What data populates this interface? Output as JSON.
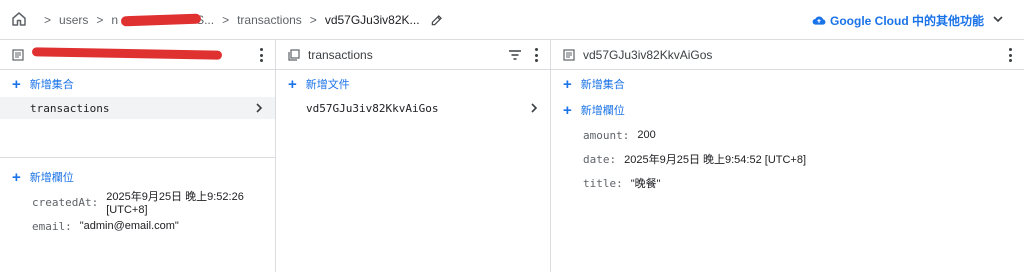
{
  "breadcrumb": {
    "items": [
      "users",
      "n",
      "transactions",
      "vd57GJu3iv82K..."
    ],
    "redacted_suffix": "S..."
  },
  "header_action": {
    "label": "Google Cloud 中的其他功能"
  },
  "panels": {
    "left": {
      "add_collection": "新增集合",
      "collections": [
        "transactions"
      ],
      "add_field": "新增欄位",
      "fields": [
        {
          "key": "createdAt:",
          "value": "2025年9月25日 晚上9:52:26 [UTC+8]"
        },
        {
          "key": "email:",
          "value": "\"admin@email.com\""
        }
      ]
    },
    "middle": {
      "title": "transactions",
      "add_document": "新增文件",
      "documents": [
        "vd57GJu3iv82KkvAiGos"
      ]
    },
    "right": {
      "title": "vd57GJu3iv82KkvAiGos",
      "add_collection": "新增集合",
      "add_field": "新增欄位",
      "fields": [
        {
          "key": "amount:",
          "value": "200"
        },
        {
          "key": "date:",
          "value": "2025年9月25日 晚上9:54:52 [UTC+8]"
        },
        {
          "key": "title:",
          "value": "\"晚餐\""
        }
      ]
    }
  },
  "colors": {
    "accent": "#1a73e8",
    "redaction": "#e03131",
    "border": "#dadce0",
    "selected_bg": "#f1f3f4"
  }
}
